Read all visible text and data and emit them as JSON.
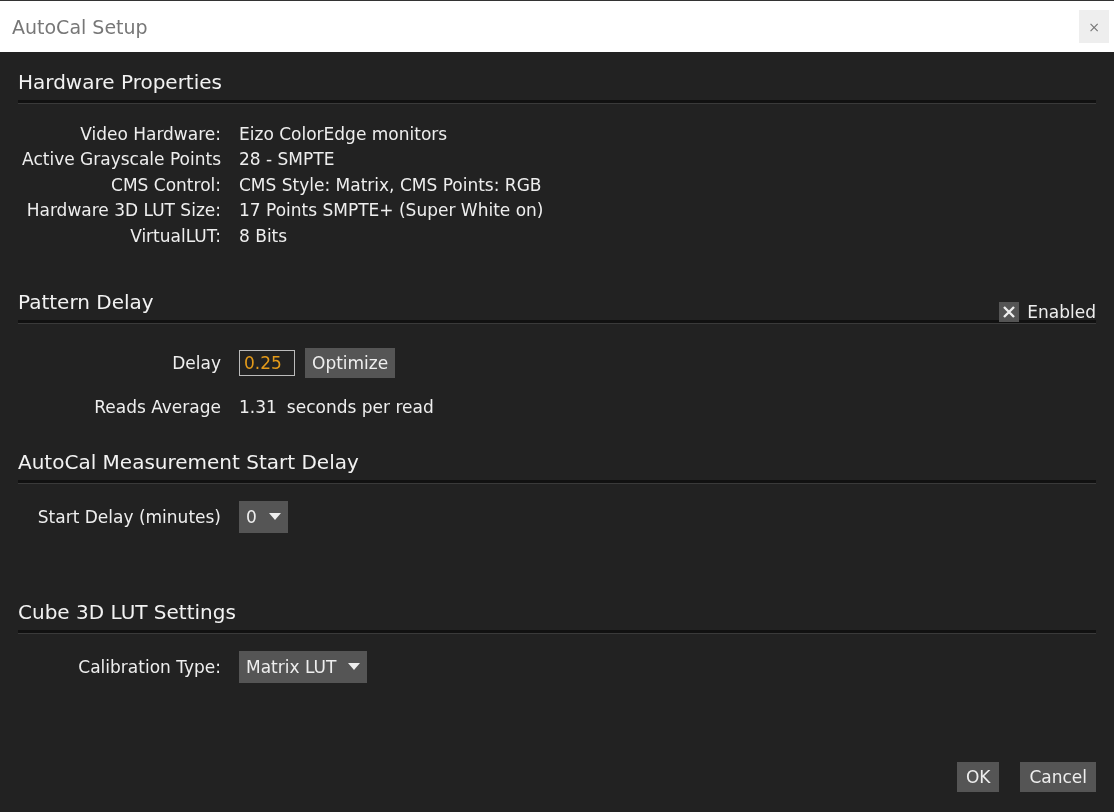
{
  "window": {
    "title": "AutoCal Setup",
    "close": "×"
  },
  "sections": [
    {
      "title": "Hardware Properties",
      "rows": [
        {
          "kind": "info",
          "label": "Video Hardware:",
          "value": "Eizo ColorEdge monitors"
        },
        {
          "kind": "info",
          "label": "Active Grayscale Points",
          "value": "28 - SMPTE"
        },
        {
          "kind": "info",
          "label": "CMS Control:",
          "value": "CMS Style: Matrix, CMS Points: RGB"
        },
        {
          "kind": "info",
          "label": "Hardware 3D LUT Size:",
          "value": "17 Points SMPTE+ (Super White on)"
        },
        {
          "kind": "info",
          "label": "VirtualLUT:",
          "value": "8 Bits"
        }
      ]
    },
    {
      "title": "Pattern Delay",
      "toggle": {
        "label": "Enabled",
        "checked": true
      },
      "rows": [
        {
          "kind": "input",
          "label": "Delay",
          "value": "0.25",
          "button": "Optimize"
        },
        {
          "kind": "reading",
          "label": "Reads Average",
          "value": "1.31",
          "unit": "seconds per read"
        }
      ]
    },
    {
      "title": "AutoCal Measurement Start Delay",
      "rows": [
        {
          "kind": "select",
          "label": "Start Delay (minutes)",
          "value": "0"
        }
      ]
    },
    {
      "title": "Cube 3D LUT Settings",
      "rows": [
        {
          "kind": "select",
          "label": "Calibration Type:",
          "value": "Matrix LUT"
        }
      ]
    }
  ],
  "buttons": [
    "OK",
    "Cancel"
  ]
}
